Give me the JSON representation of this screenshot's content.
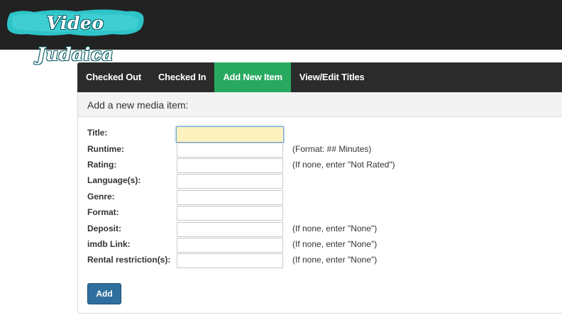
{
  "brand": {
    "logo_text": "Video Judaica",
    "accent": "#2ec4c9"
  },
  "nav": {
    "items": [
      {
        "label": "Checked Out",
        "active": false
      },
      {
        "label": "Checked In",
        "active": false
      },
      {
        "label": "Add New Item",
        "active": true
      },
      {
        "label": "View/Edit Titles",
        "active": false
      }
    ],
    "active_color": "#28a960"
  },
  "panel": {
    "heading": "Add a new media item:"
  },
  "form": {
    "fields": [
      {
        "label": "Title:",
        "value": "",
        "hint": ""
      },
      {
        "label": "Runtime:",
        "value": "",
        "hint": "(Format: ## Minutes)"
      },
      {
        "label": "Rating:",
        "value": "",
        "hint": "(If none, enter \"Not Rated\")"
      },
      {
        "label": "Language(s):",
        "value": "",
        "hint": ""
      },
      {
        "label": "Genre:",
        "value": "",
        "hint": ""
      },
      {
        "label": "Format:",
        "value": "",
        "hint": ""
      },
      {
        "label": "Deposit:",
        "value": "",
        "hint": "(If none, enter \"None\")"
      },
      {
        "label": "imdb Link:",
        "value": "",
        "hint": "(If none, enter \"None\")"
      },
      {
        "label": "Rental restriction(s):",
        "value": "",
        "hint": "(If none, enter \"None\")"
      }
    ],
    "submit_label": "Add"
  }
}
